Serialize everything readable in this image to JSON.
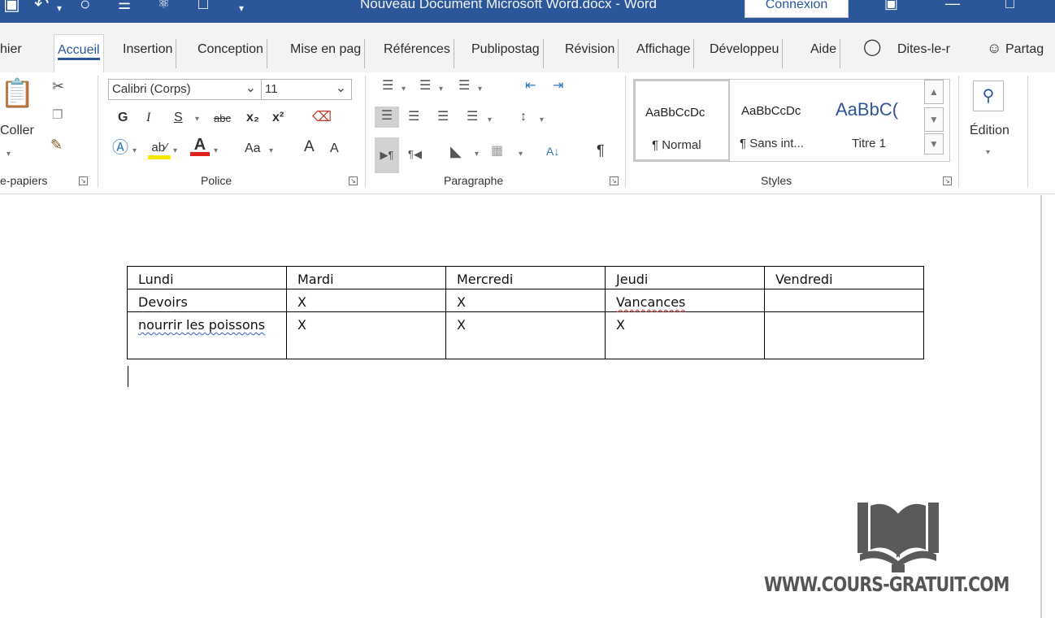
{
  "titlebar": {
    "doc_title": "Nouveau Document Microsoft Word.docx  -  Word",
    "signin": "Connexion",
    "undo_icon": "undo-icon",
    "redo_icon": "redo-icon"
  },
  "tabs": [
    {
      "label": "hier"
    },
    {
      "label": "Accueil"
    },
    {
      "label": "Insertion"
    },
    {
      "label": "Conception"
    },
    {
      "label": "Mise en pag"
    },
    {
      "label": "Références"
    },
    {
      "label": "Publipostag"
    },
    {
      "label": "Révision"
    },
    {
      "label": "Affichage"
    },
    {
      "label": "Développeu"
    },
    {
      "label": "Aide"
    },
    {
      "label": "Dites-le-r"
    },
    {
      "label": "Partag"
    }
  ],
  "ribbon": {
    "clipboard": {
      "paste_label": "Coller",
      "group_label": "e-papiers"
    },
    "font": {
      "family": "Calibri (Corps)",
      "size": "11",
      "bold": "G",
      "italic": "I",
      "underline": "S",
      "strike": "abc",
      "subscript": "x₂",
      "superscript": "x²",
      "case": "Aa",
      "grow": "A",
      "shrink": "A",
      "group_label": "Police"
    },
    "paragraph": {
      "group_label": "Paragraphe",
      "show_marks": "¶"
    },
    "styles": {
      "items": [
        {
          "sample": "AaBbCcDc",
          "name": "¶ Normal"
        },
        {
          "sample": "AaBbCcDc",
          "name": "¶ Sans int..."
        },
        {
          "sample": "AaBbC(",
          "name": "Titre 1"
        }
      ],
      "group_label": "Styles"
    },
    "editing": {
      "label": "Édition"
    }
  },
  "table": {
    "rows": [
      [
        "Lundi",
        "Mardi",
        "Mercredi",
        "Jeudi",
        "Vendredi"
      ],
      [
        "Devoirs",
        "X",
        "X",
        "Vancances",
        ""
      ],
      [
        "nourrir les poissons",
        "X",
        "X",
        "X",
        ""
      ]
    ]
  },
  "watermark": {
    "text": "WWW.COURS-GRATUIT.COM"
  },
  "colors": {
    "accent": "#2b579a",
    "spell_error": "#d03030"
  }
}
